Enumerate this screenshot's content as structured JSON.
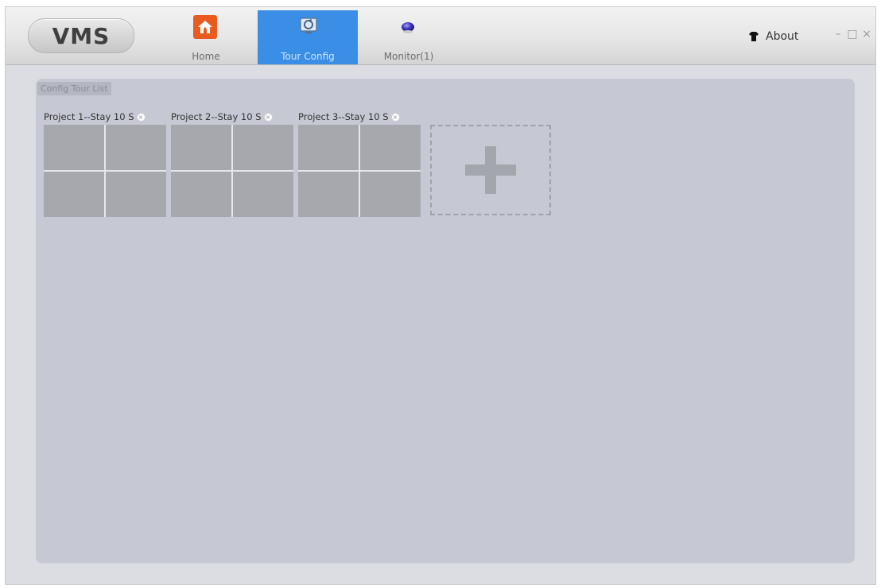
{
  "app": {
    "logo": "VMS"
  },
  "nav": {
    "home": "Home",
    "tour_config": "Tour Config",
    "monitor": "Monitor(1)"
  },
  "toolbar": {
    "about": "About",
    "minimize": "–",
    "maximize": "□",
    "close": "×"
  },
  "panel": {
    "title": "Config Tour List"
  },
  "projects": [
    {
      "label": "Project 1--Stay 10 S",
      "close": "×"
    },
    {
      "label": "Project 2--Stay 10 S",
      "close": "×"
    },
    {
      "label": "Project 3--Stay 10 S",
      "close": "×"
    }
  ],
  "icons": {
    "home": "home-icon",
    "tour": "tour-config-icon",
    "monitor": "monitor-icon",
    "about": "shirt-icon",
    "add": "plus-icon"
  },
  "colors": {
    "active_tab": "#3a8ee6",
    "home_icon": "#e85a1e",
    "panel_bg": "#c6c9d3",
    "cell": "#a7a8ae"
  }
}
